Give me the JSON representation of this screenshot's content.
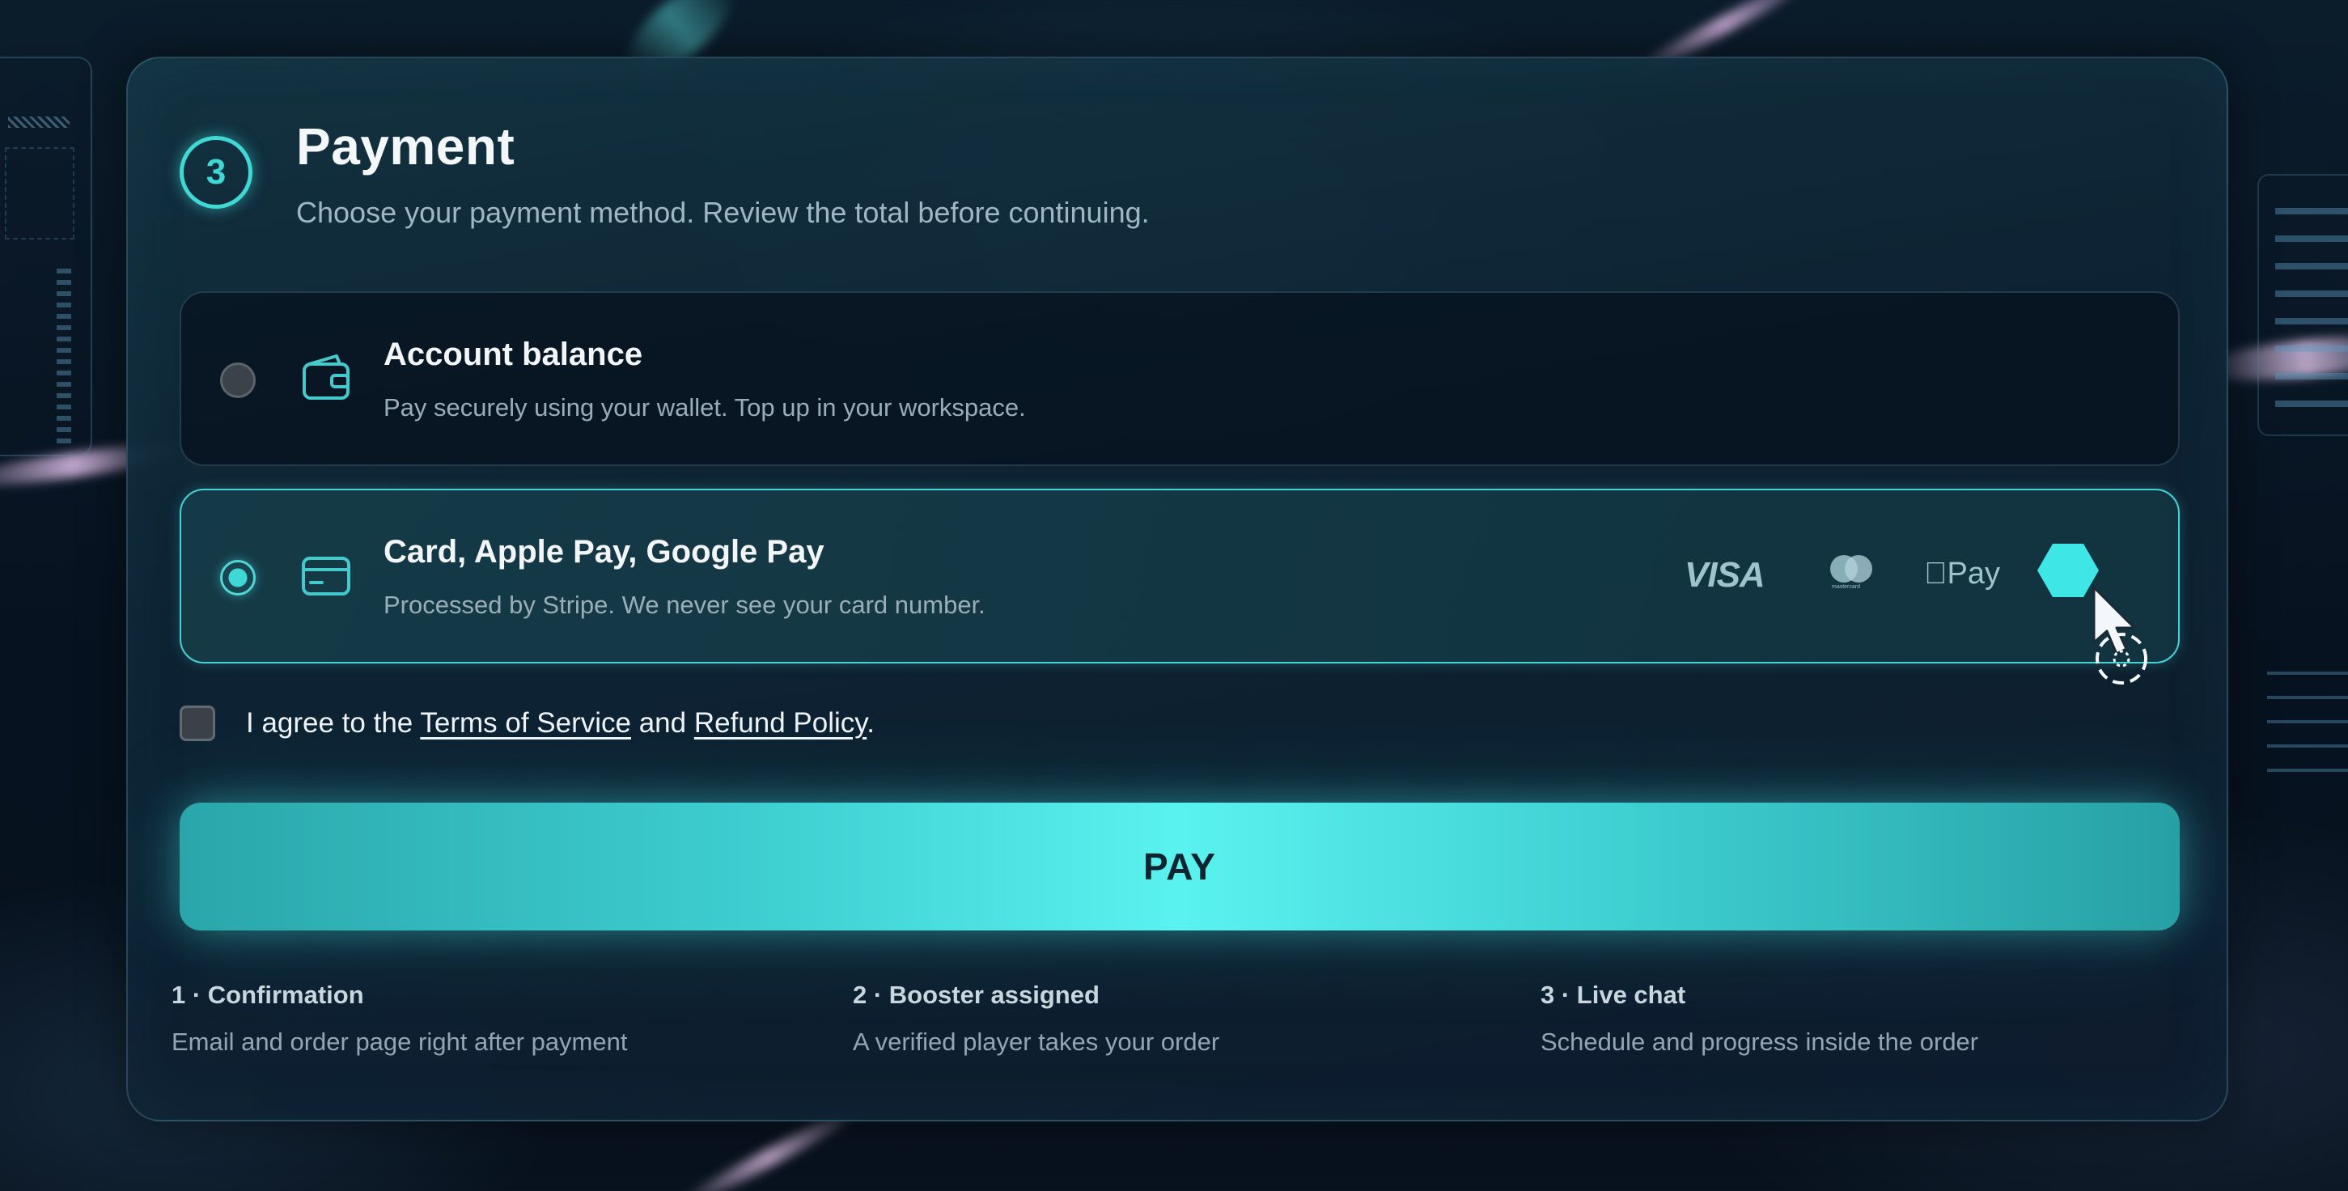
{
  "step": {
    "number": "3",
    "title": "Payment",
    "subtitle": "Choose your payment method. Review the total before continuing."
  },
  "options": [
    {
      "title": "Account balance",
      "description": "Pay securely using your wallet. Top up in your workspace.",
      "selected": false,
      "icon": "wallet-icon"
    },
    {
      "title": "Card, Apple Pay, Google Pay",
      "description": "Processed by Stripe. We never see your card number.",
      "selected": true,
      "icon": "credit-card-icon",
      "brands": {
        "visa": "VISA",
        "mastercard": "mastercard",
        "apple_pay": "Pay"
      }
    }
  ],
  "agreement": {
    "prefix": "I agree to the ",
    "terms_link": "Terms of Service",
    "middle": " and ",
    "refund_link": "Refund Policy",
    "suffix": ".",
    "checked": false
  },
  "pay_button": "PAY",
  "next_steps": [
    {
      "title": "1 · Confirmation",
      "description": "Email and order page right after payment"
    },
    {
      "title": "2 · Booster assigned",
      "description": "A verified player takes your order"
    },
    {
      "title": "3 · Live chat",
      "description": "Schedule and progress inside the order"
    }
  ],
  "colors": {
    "accent": "#3fd8d4",
    "background": "#071321",
    "card": "#10283a"
  }
}
